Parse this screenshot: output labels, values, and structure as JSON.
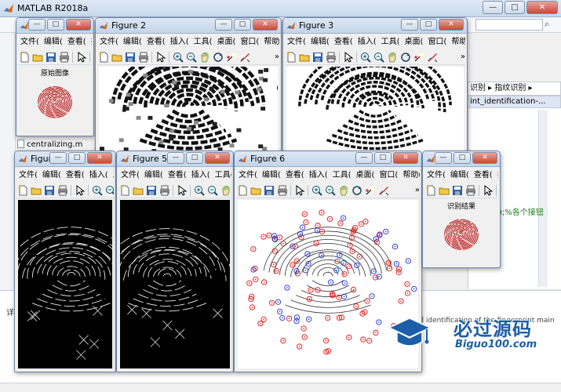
{
  "main_window": {
    "title": "MATLAB R2018a",
    "breadcrumb": "识别 ▸ 指纹识别 ▸",
    "editor_tab": "int_identification-...",
    "code_snippet": ");%各个接钮",
    "file_name": "centralizing.m",
    "cmd_partial": "al identification of the fingerprint main",
    "left_label": "详",
    "min_label": "—",
    "max_label": "□",
    "close_label": "✕"
  },
  "figure_menu": [
    "文件(",
    "编辑(",
    "查看(",
    "插入(",
    "工具(",
    "桌面(",
    "窗口(",
    "帮助("
  ],
  "figure_menu_more": "»",
  "toolbar_more": "»",
  "figures": [
    {
      "title": "",
      "caption": "原始图像"
    },
    {
      "title": "Figure 2"
    },
    {
      "title": "Figure 3"
    },
    {
      "title": "Figure 4"
    },
    {
      "title": "Figure 5"
    },
    {
      "title": "Figure 6"
    },
    {
      "title": "",
      "caption": "识别结果"
    }
  ],
  "watermark": {
    "main": "必过源码",
    "sub": "Biguo100.com"
  },
  "colors": {
    "titlebar": "#c4d5ea",
    "accent": "#1c5fa8",
    "marker_red": "#e01010",
    "marker_blue": "#2030d0"
  }
}
